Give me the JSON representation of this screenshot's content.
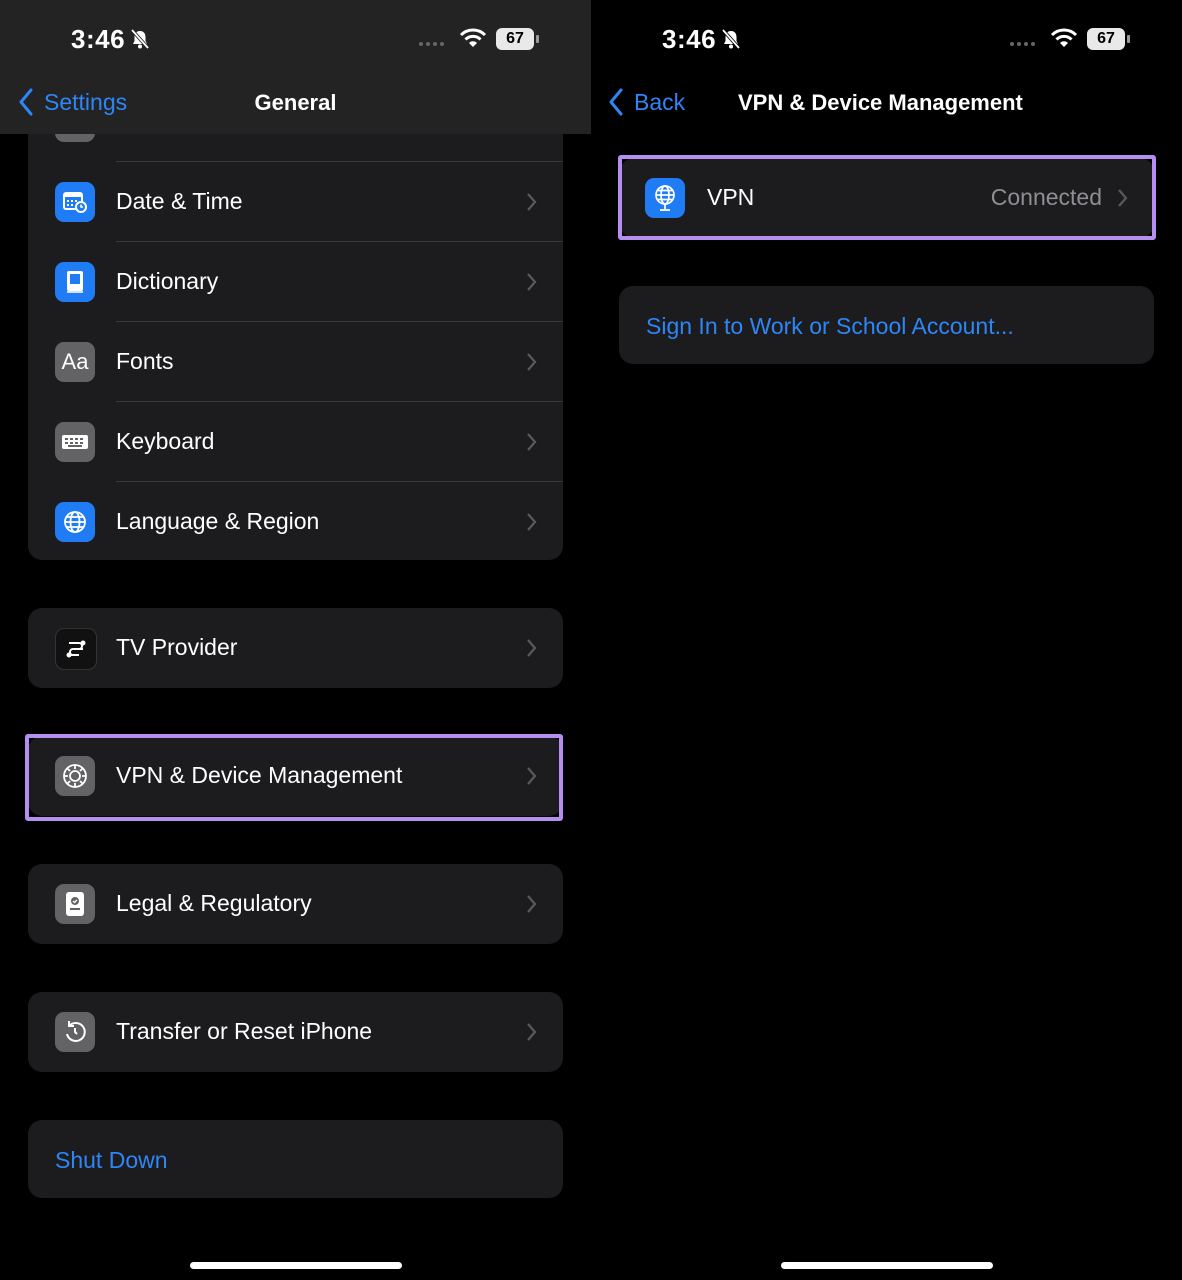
{
  "left": {
    "status": {
      "time": "3:46",
      "battery": "67"
    },
    "nav": {
      "back_label": "Settings",
      "title": "General"
    },
    "group_main": [
      {
        "label": "Date & Time",
        "icon": "calendar-clock-icon",
        "color": "#1f7cf5"
      },
      {
        "label": "Dictionary",
        "icon": "book-icon",
        "color": "#1f7cf5"
      },
      {
        "label": "Fonts",
        "icon": "fonts-icon",
        "color": "#636366"
      },
      {
        "label": "Keyboard",
        "icon": "keyboard-icon",
        "color": "#636366"
      },
      {
        "label": "Language & Region",
        "icon": "globe-icon",
        "color": "#1f7cf5"
      }
    ],
    "tv_provider": {
      "label": "TV Provider"
    },
    "vpn_device": {
      "label": "VPN & Device Management"
    },
    "legal": {
      "label": "Legal & Regulatory"
    },
    "transfer": {
      "label": "Transfer or Reset iPhone"
    },
    "shutdown": {
      "label": "Shut Down"
    }
  },
  "right": {
    "status": {
      "time": "3:46",
      "battery": "67"
    },
    "nav": {
      "back_label": "Back",
      "title": "VPN & Device Management"
    },
    "vpn": {
      "label": "VPN",
      "value": "Connected"
    },
    "sign_in": {
      "label": "Sign In to Work or School Account..."
    }
  },
  "colors": {
    "accent": "#2e86f6",
    "highlight": "#b48ef0",
    "cell": "#1c1c1e"
  }
}
